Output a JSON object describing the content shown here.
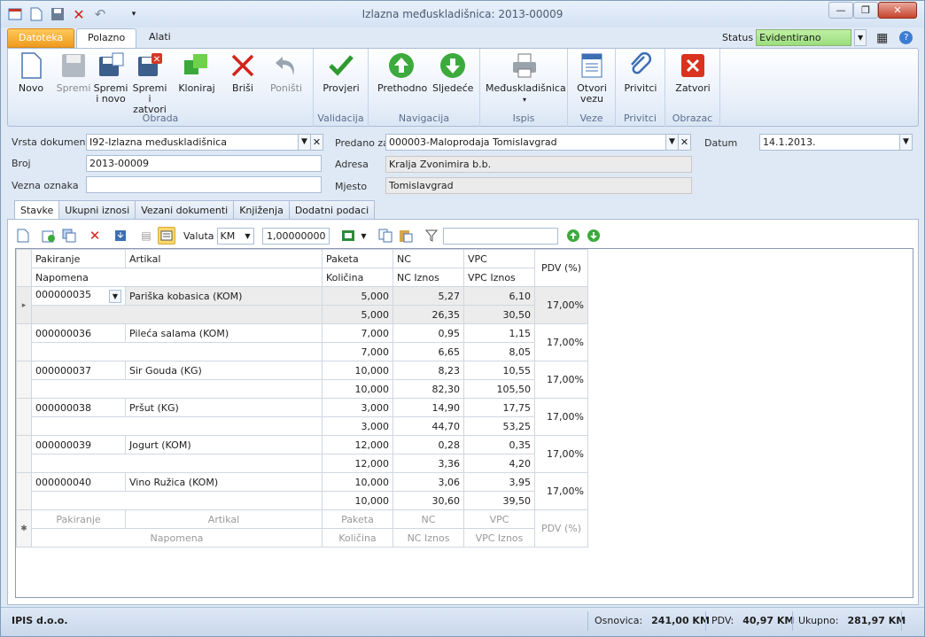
{
  "window": {
    "title": "Izlazna međuskladišnica: 2013-00009",
    "min": "0",
    "max": "1",
    "close": "r"
  },
  "ribbon_tabs": [
    "Datoteka",
    "Polazno",
    "Alati"
  ],
  "status": {
    "label": "Status",
    "value": "Evidentirano"
  },
  "groups": {
    "obrada": "Obrada",
    "validacija": "Validacija",
    "navigacija": "Navigacija",
    "ispis": "Ispis",
    "veze": "Veze",
    "privitci": "Privitci",
    "obrazac": "Obrazac"
  },
  "buttons": {
    "novo": "Novo",
    "spremi": "Spremi",
    "spremi_novo": "Spremi i novo",
    "spremi_zatvori": "Spremi i zatvori",
    "kloniraj": "Kloniraj",
    "brisi": "Briši",
    "ponisti": "Poništi",
    "provjeri": "Provjeri",
    "prethodno": "Prethodno",
    "sljedece": "Sljedeće",
    "medjuskladisnica": "Međuskladišnica",
    "otvori_vezu": "Otvori vezu",
    "privitci": "Privitci",
    "zatvori": "Zatvori"
  },
  "form": {
    "vrsta_label": "Vrsta dokumenta",
    "vrsta_value": "I92-Izlazna međuskladišnica",
    "broj_label": "Broj",
    "broj_value": "2013-00009",
    "vezna_label": "Vezna oznaka",
    "vezna_value": "",
    "predano_label": "Predano za",
    "predano_value": "000003-Maloprodaja Tomislavgrad",
    "adresa_label": "Adresa",
    "adresa_value": "Kralja Zvonimira b.b.",
    "mjesto_label": "Mjesto",
    "mjesto_value": "Tomislavgrad",
    "datum_label": "Datum",
    "datum_value": "14.1.2013."
  },
  "doc_tabs": [
    "Stavke",
    "Ukupni iznosi",
    "Vezani dokumenti",
    "Knjiženja",
    "Dodatni podaci"
  ],
  "toolbar": {
    "valuta_label": "Valuta",
    "valuta_value": "KM",
    "tecaj": "1,00000000",
    "filter_value": ""
  },
  "grid": {
    "headers": {
      "pakiranje": "Pakiranje",
      "artikal": "Artikal",
      "paketa": "Paketa",
      "nc": "NC",
      "vpc": "VPC",
      "pdv": "PDV (%)",
      "napomena": "Napomena",
      "kolicina": "Količina",
      "nc_iznos": "NC Iznos",
      "vpc_iznos": "VPC Iznos"
    },
    "rows": [
      {
        "pakiranje": "000000035",
        "artikal": "Pariška kobasica (KOM)",
        "paketa": "5,000",
        "nc": "5,27",
        "vpc": "6,10",
        "kolicina": "5,000",
        "nc_iznos": "26,35",
        "vpc_iznos": "30,50",
        "pdv": "17,00%"
      },
      {
        "pakiranje": "000000036",
        "artikal": "Pileća salama (KOM)",
        "paketa": "7,000",
        "nc": "0,95",
        "vpc": "1,15",
        "kolicina": "7,000",
        "nc_iznos": "6,65",
        "vpc_iznos": "8,05",
        "pdv": "17,00%"
      },
      {
        "pakiranje": "000000037",
        "artikal": "Sir Gouda (KG)",
        "paketa": "10,000",
        "nc": "8,23",
        "vpc": "10,55",
        "kolicina": "10,000",
        "nc_iznos": "82,30",
        "vpc_iznos": "105,50",
        "pdv": "17,00%"
      },
      {
        "pakiranje": "000000038",
        "artikal": "Pršut (KG)",
        "paketa": "3,000",
        "nc": "14,90",
        "vpc": "17,75",
        "kolicina": "3,000",
        "nc_iznos": "44,70",
        "vpc_iznos": "53,25",
        "pdv": "17,00%"
      },
      {
        "pakiranje": "000000039",
        "artikal": "Jogurt (KOM)",
        "paketa": "12,000",
        "nc": "0,28",
        "vpc": "0,35",
        "kolicina": "12,000",
        "nc_iznos": "3,36",
        "vpc_iznos": "4,20",
        "pdv": "17,00%"
      },
      {
        "pakiranje": "000000040",
        "artikal": "Vino Ružica (KOM)",
        "paketa": "10,000",
        "nc": "3,06",
        "vpc": "3,95",
        "kolicina": "10,000",
        "nc_iznos": "30,60",
        "vpc_iznos": "39,50",
        "pdv": "17,00%"
      }
    ]
  },
  "statusbar": {
    "company": "IPIS d.o.o.",
    "osnovica_label": "Osnovica:",
    "osnovica": "241,00 KM",
    "pdv_label": "PDV:",
    "pdv": "40,97 KM",
    "ukupno_label": "Ukupno:",
    "ukupno": "281,97 KM"
  }
}
